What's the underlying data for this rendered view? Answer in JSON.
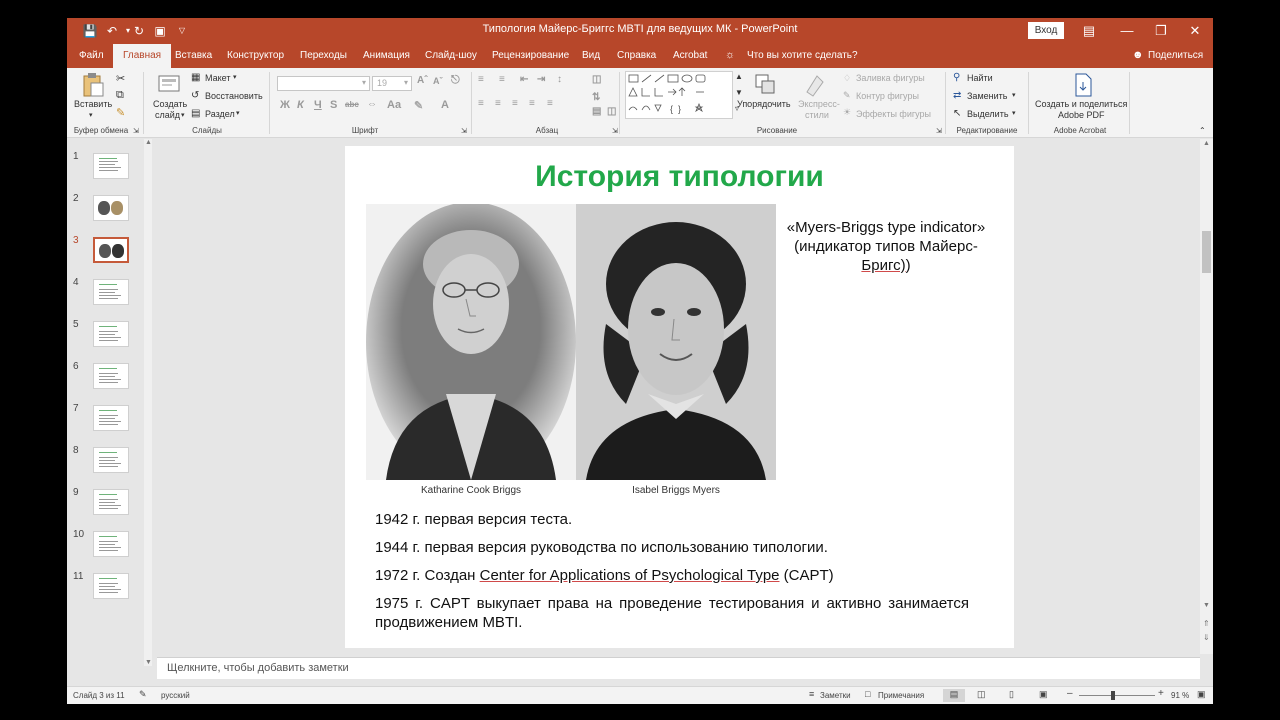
{
  "window": {
    "title": "Типология Майерс-Бриггс MBTI для ведущих МК  -  PowerPoint",
    "signin_label": "Вход"
  },
  "tabs": {
    "items": [
      "Файл",
      "Главная",
      "Вставка",
      "Конструктор",
      "Переходы",
      "Анимация",
      "Слайд-шоу",
      "Рецензирование",
      "Вид",
      "Справка",
      "Acrobat"
    ],
    "active": "Главная",
    "tell_me": "Что вы хотите сделать?",
    "share": "Поделиться"
  },
  "ribbon": {
    "clipboard": {
      "paste": "Вставить",
      "group": "Буфер обмена"
    },
    "slides": {
      "new_slide_1": "Создать",
      "new_slide_2": "слайд",
      "layout": "Макет",
      "reset": "Восстановить",
      "section": "Раздел",
      "group": "Слайды"
    },
    "font": {
      "size": "19",
      "group": "Шрифт",
      "bold": "Ж",
      "italic": "К",
      "underline": "Ч",
      "strike": "S",
      "shadow": "abc"
    },
    "paragraph": {
      "group": "Абзац"
    },
    "drawing": {
      "arrange": "Упорядочить",
      "quick_styles_1": "Экспресс-",
      "quick_styles_2": "стили",
      "fill": "Заливка фигуры",
      "outline": "Контур фигуры",
      "effects": "Эффекты фигуры",
      "group": "Рисование"
    },
    "editing": {
      "find": "Найти",
      "replace": "Заменить",
      "select": "Выделить",
      "group": "Редактирование"
    },
    "acrobat": {
      "create_1": "Создать и поделиться",
      "create_2": "Adobe PDF",
      "group": "Adobe Acrobat"
    }
  },
  "thumbnails": {
    "selected": 3,
    "numbers": [
      "1",
      "2",
      "3",
      "4",
      "5",
      "6",
      "7",
      "8",
      "9",
      "10",
      "11"
    ]
  },
  "slide": {
    "title": "История типологии",
    "photo_left_caption": "Katharine Cook Briggs",
    "photo_right_caption": "Isabel Briggs Myers",
    "mbti_line1": "«Myers-Briggs type indicator»",
    "mbti_line2": "(индикатор типов Майерс-",
    "mbti_line3": "Бригс)",
    "timeline": [
      {
        "text": "1942 г. первая версия теста."
      },
      {
        "text": "1944 г. первая версия руководства по использованию типологии."
      },
      {
        "prefix": "1972 г.  Создан ",
        "link": "Center for Applications of Psychological Type",
        "suffix": " (CAPT)"
      },
      {
        "text": "1975 г. CAPT выкупает права на проведение тестирования и активно занимается продвижением MBTI."
      }
    ]
  },
  "notes": {
    "placeholder": "Щелкните, чтобы добавить заметки"
  },
  "status": {
    "slide_info": "Слайд 3 из 11",
    "language": "русский",
    "notes_btn": "Заметки",
    "comments_btn": "Примечания",
    "zoom_percent": "91 %",
    "zoom_fraction": 0.45
  }
}
